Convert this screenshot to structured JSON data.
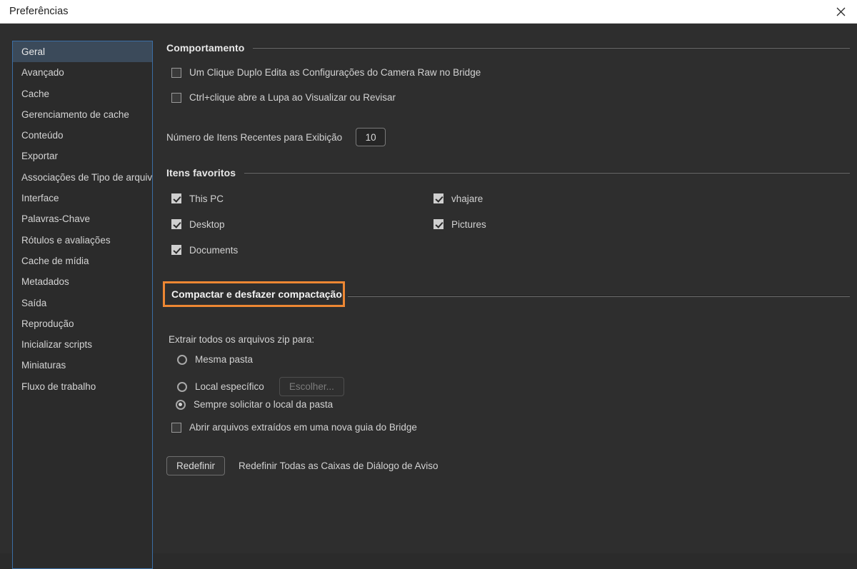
{
  "window": {
    "title": "Preferências",
    "close_icon": "close-icon"
  },
  "sidebar": {
    "items": [
      {
        "label": "Geral",
        "selected": true
      },
      {
        "label": "Avançado",
        "selected": false
      },
      {
        "label": "Cache",
        "selected": false
      },
      {
        "label": "Gerenciamento de cache",
        "selected": false
      },
      {
        "label": "Conteúdo",
        "selected": false
      },
      {
        "label": "Exportar",
        "selected": false
      },
      {
        "label": "Associações de Tipo de arquivo",
        "selected": false
      },
      {
        "label": "Interface",
        "selected": false
      },
      {
        "label": "Palavras-Chave",
        "selected": false
      },
      {
        "label": "Rótulos e avaliações",
        "selected": false
      },
      {
        "label": "Cache de mídia",
        "selected": false
      },
      {
        "label": "Metadados",
        "selected": false
      },
      {
        "label": "Saída",
        "selected": false
      },
      {
        "label": "Reprodução",
        "selected": false
      },
      {
        "label": "Inicializar scripts",
        "selected": false
      },
      {
        "label": "Miniaturas",
        "selected": false
      },
      {
        "label": "Fluxo de trabalho",
        "selected": false
      }
    ]
  },
  "behavior": {
    "heading": "Comportamento",
    "checkbox_double_click": {
      "label": "Um Clique Duplo Edita as Configurações do Camera Raw no Bridge",
      "checked": false
    },
    "checkbox_ctrl_click": {
      "label": "Ctrl+clique abre a Lupa ao Visualizar ou Revisar",
      "checked": false
    },
    "recent_items": {
      "label": "Número de Itens Recentes para Exibição",
      "value": "10"
    }
  },
  "favorites": {
    "heading": "Itens favoritos",
    "left_column": [
      {
        "label": "This PC",
        "checked": true
      },
      {
        "label": "Desktop",
        "checked": true
      },
      {
        "label": "Documents",
        "checked": true
      }
    ],
    "right_column": [
      {
        "label": "vhajare",
        "checked": true
      },
      {
        "label": "Pictures",
        "checked": true
      }
    ]
  },
  "compress": {
    "heading": "Compactar e desfazer compactação",
    "highlight_color": "#ed8733",
    "extract_label": "Extrair todos os arquivos zip para:",
    "radios": [
      {
        "label": "Mesma pasta",
        "selected": false
      },
      {
        "label": "Local específico",
        "selected": false
      },
      {
        "label": "Sempre solicitar o local da pasta",
        "selected": true
      }
    ],
    "choose_button": {
      "label": "Escolher...",
      "disabled": true
    },
    "open_new_tab": {
      "label": "Abrir arquivos extraídos em uma nova guia do Bridge",
      "checked": false
    }
  },
  "reset": {
    "button_label": "Redefinir",
    "description": "Redefinir Todas as Caixas de Diálogo de Aviso"
  }
}
